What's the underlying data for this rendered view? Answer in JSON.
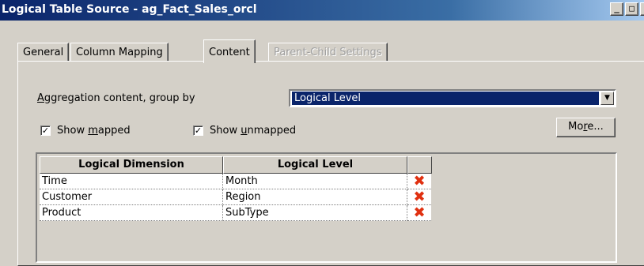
{
  "window": {
    "title": "Logical Table Source - ag_Fact_Sales_orcl",
    "controls": [
      "_",
      "□",
      "×"
    ]
  },
  "tabs": [
    {
      "label": "General",
      "state": "normal"
    },
    {
      "label": "Column Mapping",
      "state": "normal"
    },
    {
      "label": "Content",
      "state": "active"
    },
    {
      "label": "Parent-Child Settings",
      "state": "disabled"
    }
  ],
  "content": {
    "aggregation_label_first": "A",
    "aggregation_label_rest": "ggregation content, group by",
    "aggregation_value": "Logical Level",
    "show_mapped": {
      "checked": true,
      "pre": "Show ",
      "ul": "m",
      "post": "apped"
    },
    "show_unmapped": {
      "checked": true,
      "pre": "Show ",
      "ul": "u",
      "post": "nmapped"
    },
    "more_button": {
      "pre": "Mo",
      "ul": "r",
      "post": "e..."
    },
    "table": {
      "headers": [
        "Logical Dimension",
        "Logical Level"
      ],
      "rows": [
        {
          "dimension": "Time",
          "level": "Month"
        },
        {
          "dimension": "Customer",
          "level": "Region"
        },
        {
          "dimension": "Product",
          "level": "SubType"
        }
      ]
    }
  },
  "colors": {
    "title_bar": "#0a246a",
    "selection": "#0a246a",
    "delete_icon": "#e03010",
    "dialog_face": "#d4d0c8"
  }
}
